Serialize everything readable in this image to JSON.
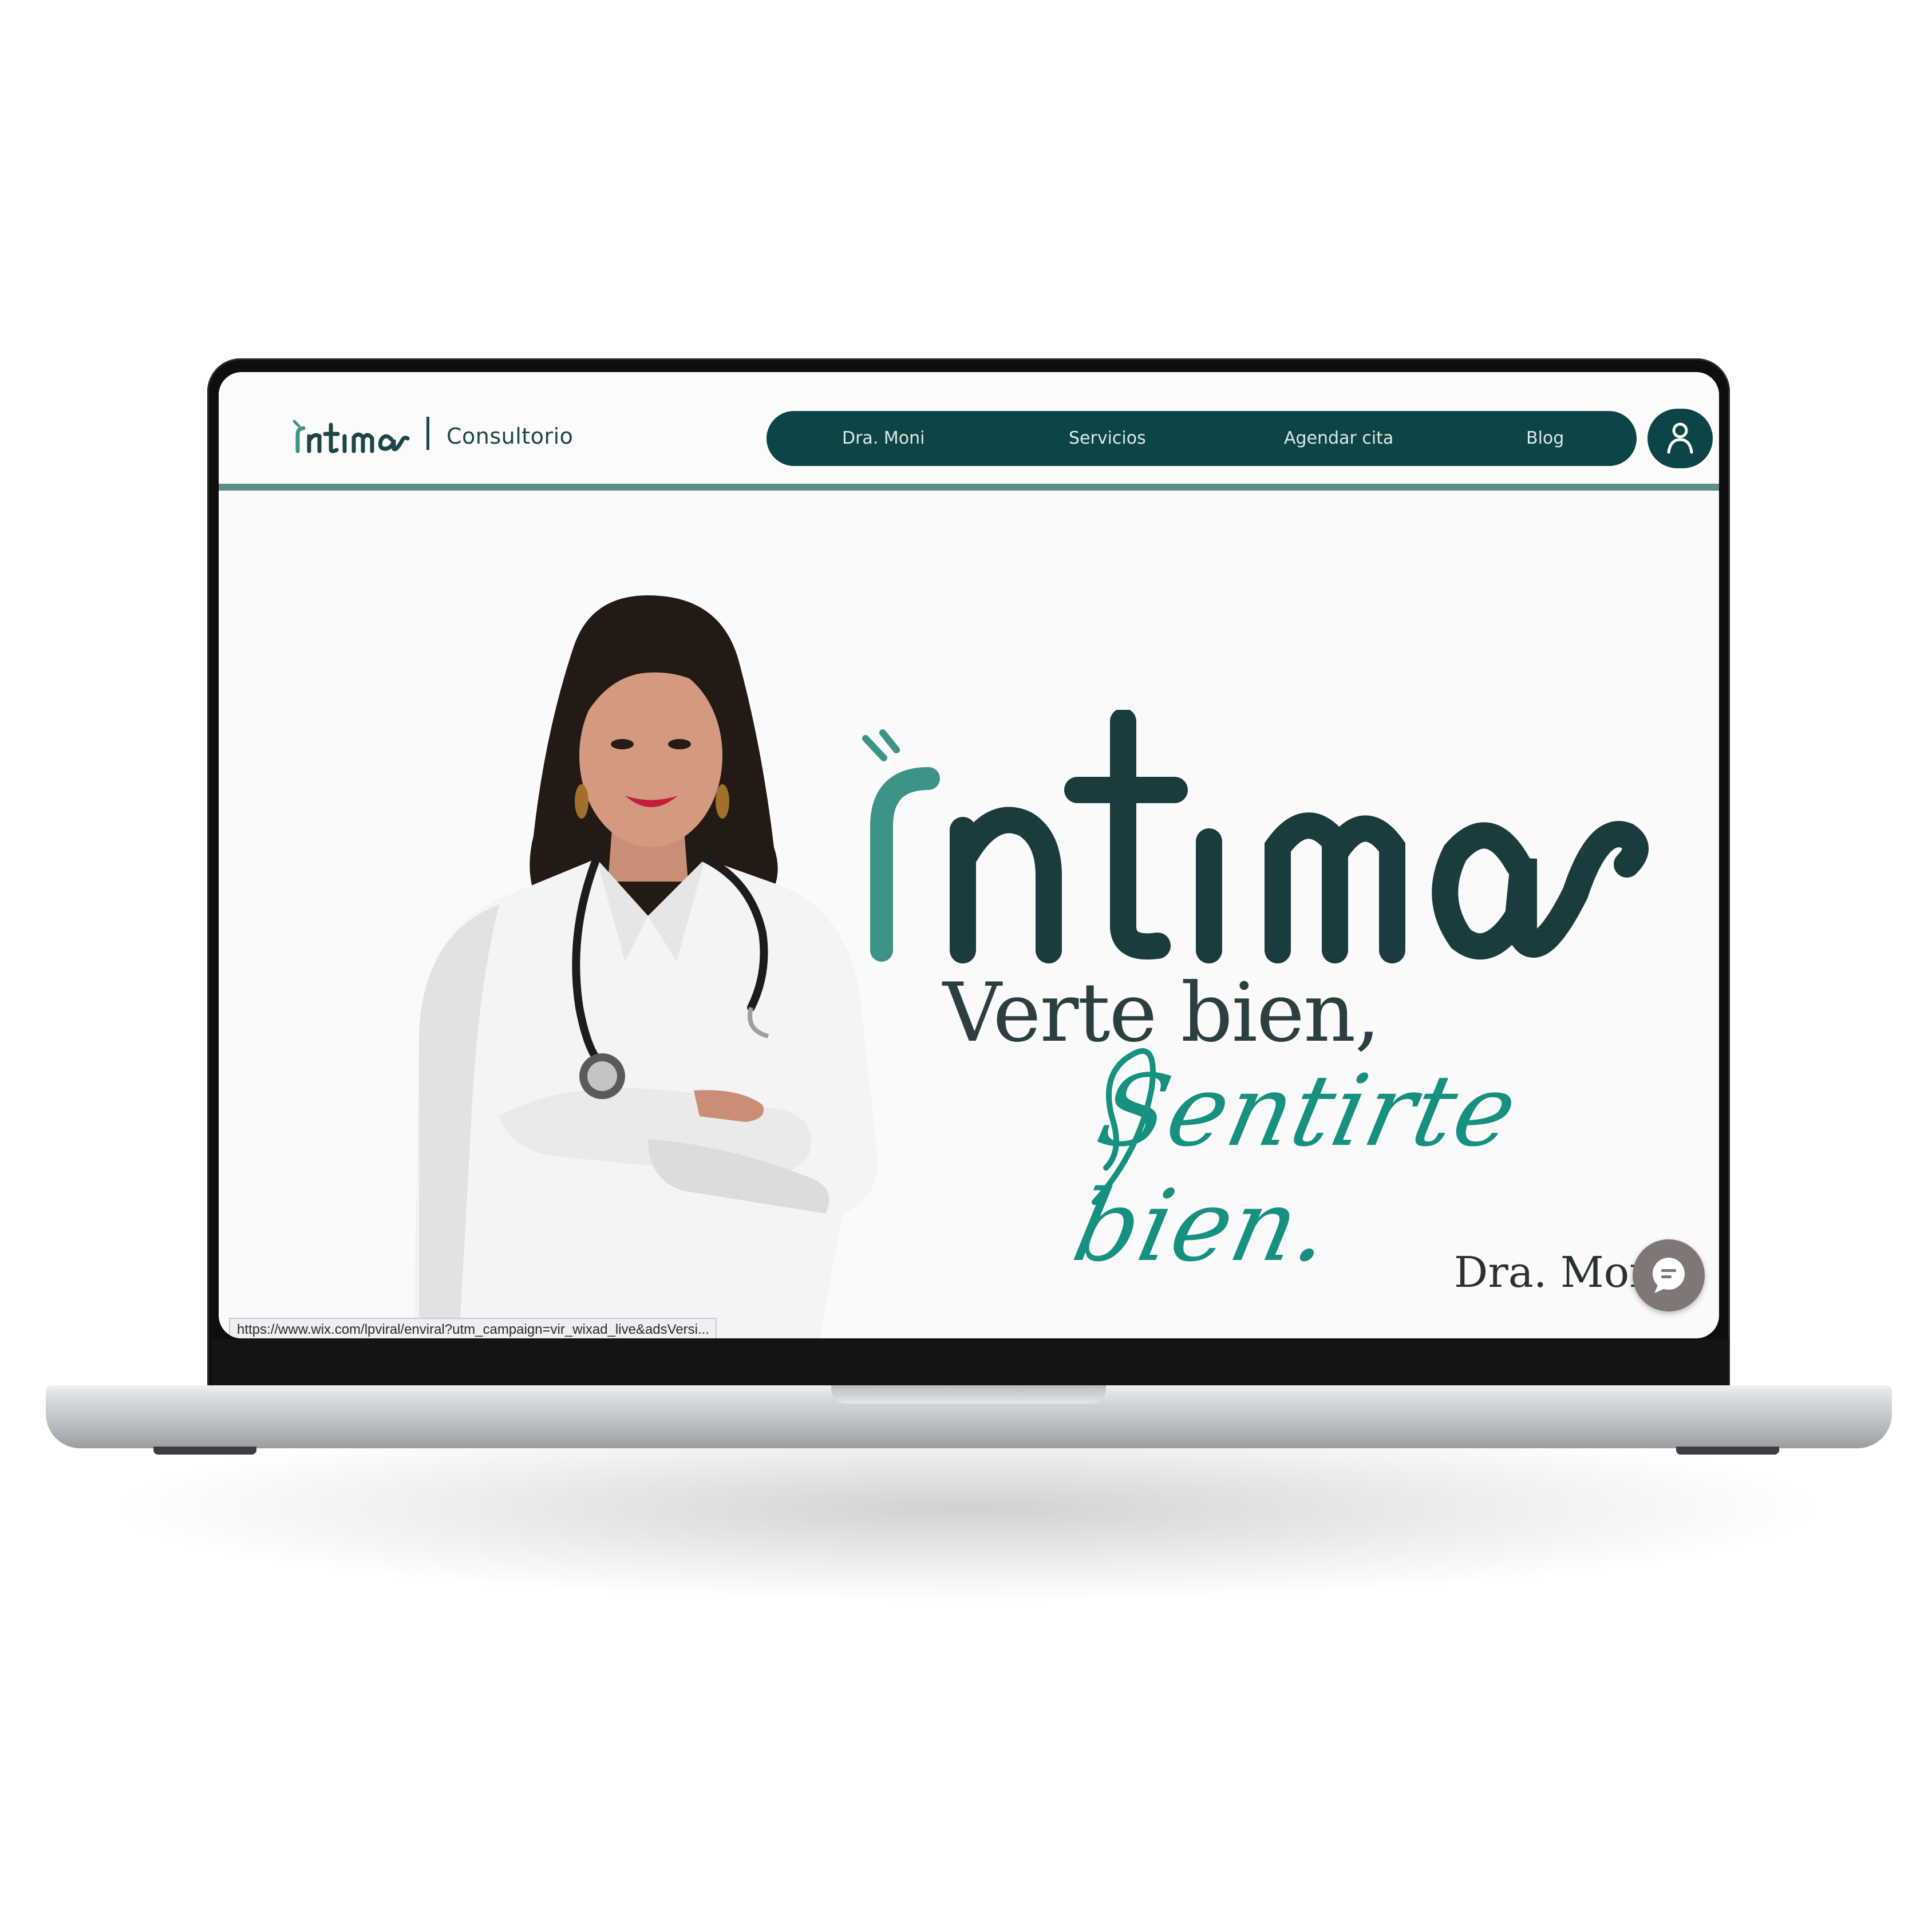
{
  "header": {
    "logo_text": "intima",
    "logo_subtitle": "Consultorio",
    "nav": [
      {
        "label": "Dra. Moni"
      },
      {
        "label": "Servicios"
      },
      {
        "label": "Agendar cita"
      },
      {
        "label": "Blog"
      }
    ],
    "account_icon": "user-icon"
  },
  "hero": {
    "logo_text": "intima",
    "tagline_1": "Verte bien,",
    "tagline_2": "Sentirte bien.",
    "signature": "Dra. Mony"
  },
  "chat": {
    "icon": "chat-bubble-icon"
  },
  "status_bar": {
    "url": "https://www.wix.com/lpviral/enviral?utm_campaign=vir_wixad_live&adsVersi..."
  },
  "colors": {
    "brand_dark": "#0d4446",
    "brand_teal": "#16907f",
    "brand_light_teal": "#3d9486",
    "text_dark": "#2b3e40"
  }
}
